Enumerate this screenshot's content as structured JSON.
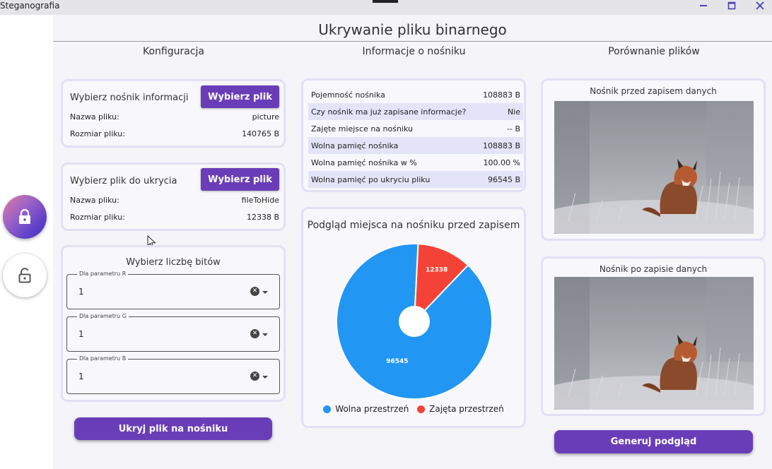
{
  "window": {
    "title": "Steganografia",
    "controls": [
      "minimize-icon",
      "maximize-icon",
      "close-icon"
    ]
  },
  "rail": {
    "items": [
      {
        "icon": "lock-closed-icon",
        "active": true
      },
      {
        "icon": "lock-open-icon",
        "active": false
      }
    ]
  },
  "page": {
    "title": "Ukrywanie pliku binarnego"
  },
  "columns": {
    "config": "Konfiguracja",
    "info": "Informacje o nośniku",
    "compare": "Porównanie plików"
  },
  "carrier": {
    "heading": "Wybierz nośnik informacji",
    "button": "Wybierz plik",
    "name_label": "Nazwa pliku:",
    "name_value": "picture",
    "size_label": "Rozmiar pliku:",
    "size_value": "140765 B"
  },
  "hidden_file": {
    "heading": "Wybierz plik do ukrycia",
    "button": "Wybierz plik",
    "name_label": "Nazwa pliku:",
    "name_value": "fileToHide",
    "size_label": "Rozmiar pliku:",
    "size_value": "12338 B"
  },
  "bits": {
    "heading": "Wybierz liczbę bitów",
    "fields": [
      {
        "label": "Dla parametru R",
        "value": "1"
      },
      {
        "label": "Dla parametru G",
        "value": "1"
      },
      {
        "label": "Dla parametru B",
        "value": "1"
      }
    ]
  },
  "hide_button": "Ukryj plik na nośniku",
  "info_table": [
    {
      "label": "Pojemność nośnika",
      "value": "108883 B"
    },
    {
      "label": "Czy nośnik ma już zapisane informacje?",
      "value": "Nie"
    },
    {
      "label": "Zajęte miejsce na nośniku",
      "value": "--  B"
    },
    {
      "label": "Wolna pamięć nośnika",
      "value": "108883 B"
    },
    {
      "label": "Wolna pamięć nośnika w %",
      "value": "100.00 %"
    },
    {
      "label": "Wolna pamięć po ukryciu pliku",
      "value": "96545 B"
    }
  ],
  "preview": {
    "title": "Podgląd miejsca na nośniku przed zapisem"
  },
  "chart_data": {
    "type": "pie",
    "subtype": "donut",
    "slices": [
      {
        "label": "Wolna przestrzeń",
        "value": 96545,
        "color": "#2196f3"
      },
      {
        "label": "Zajęta przestrzeń",
        "value": 12338,
        "color": "#f44336"
      }
    ],
    "legend_position": "bottom"
  },
  "compare": {
    "before_title": "Nośnik przed zapisem danych",
    "after_title": "Nośnik po zapisie danych",
    "button": "Generuj podgląd"
  },
  "colors": {
    "accent": "#6a3db8",
    "free": "#2196f3",
    "used": "#f44336"
  }
}
